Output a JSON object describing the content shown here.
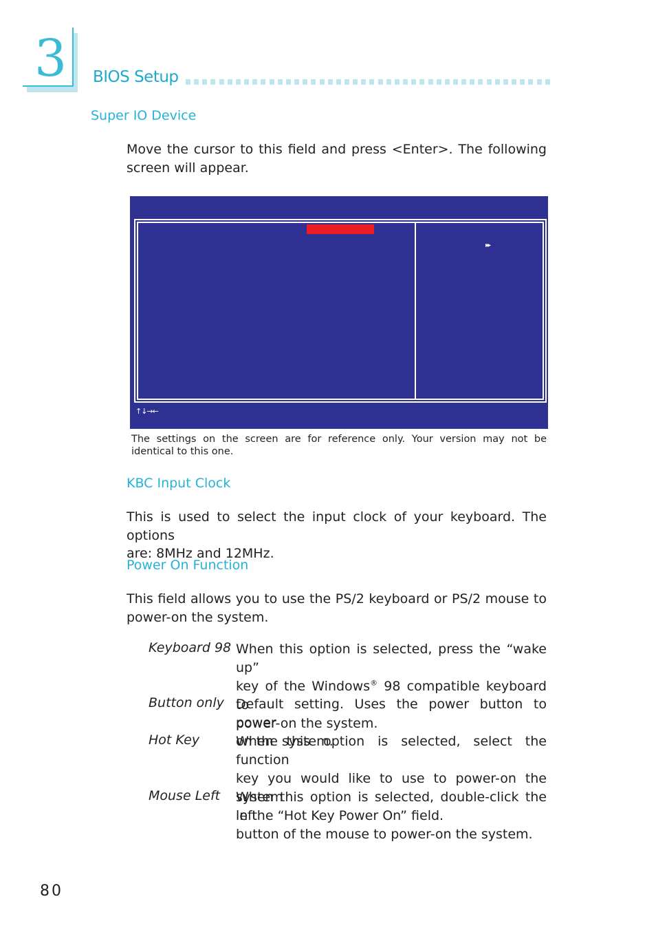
{
  "chapter": {
    "number": "3",
    "title": "BIOS Setup",
    "accent_color": "#26b2d6"
  },
  "sections": {
    "super_io": {
      "heading": "Super IO Device",
      "body_line1": "Move the cursor to this field and press <Enter>. The following",
      "body_line2": "screen will appear."
    },
    "bios_screen": {
      "background_color": "#2e3192",
      "highlight_color": "#ed1c24",
      "submenu_icon": "▸▸",
      "nav_keys": "↑↓→←",
      "caption_line1": "The settings on the screen are for reference only. Your version may not be",
      "caption_line2": "identical to this one."
    },
    "kbc_input_clock": {
      "heading": "KBC Input Clock",
      "body_line1": "This is used to select the input clock of your keyboard. The options",
      "body_line2": "are: 8MHz and 12MHz."
    },
    "power_on_function": {
      "heading": "Power On Function",
      "body_line1": "This field allows you to use the PS/2 keyboard or PS/2 mouse to",
      "body_line2": "power-on the system.",
      "options": [
        {
          "term": "Keyboard 98",
          "lines": [
            "When this option is selected, press the “wake up”",
            "key of the Windows",
            "® 98 compatible keyboard to",
            "power-on the system."
          ]
        },
        {
          "term": "Button only",
          "lines": [
            "Default setting. Uses the power button to power",
            "on the system."
          ]
        },
        {
          "term": "Hot Key",
          "lines": [
            "When this option is selected, select the function",
            "key you would like to use to power-on the system",
            "in the “Hot Key Power On” field."
          ]
        },
        {
          "term": "Mouse Left",
          "lines": [
            "When this option is selected, double-click the left",
            "button of the mouse to power-on the system."
          ]
        }
      ]
    }
  },
  "footer": {
    "page_number": "80"
  }
}
